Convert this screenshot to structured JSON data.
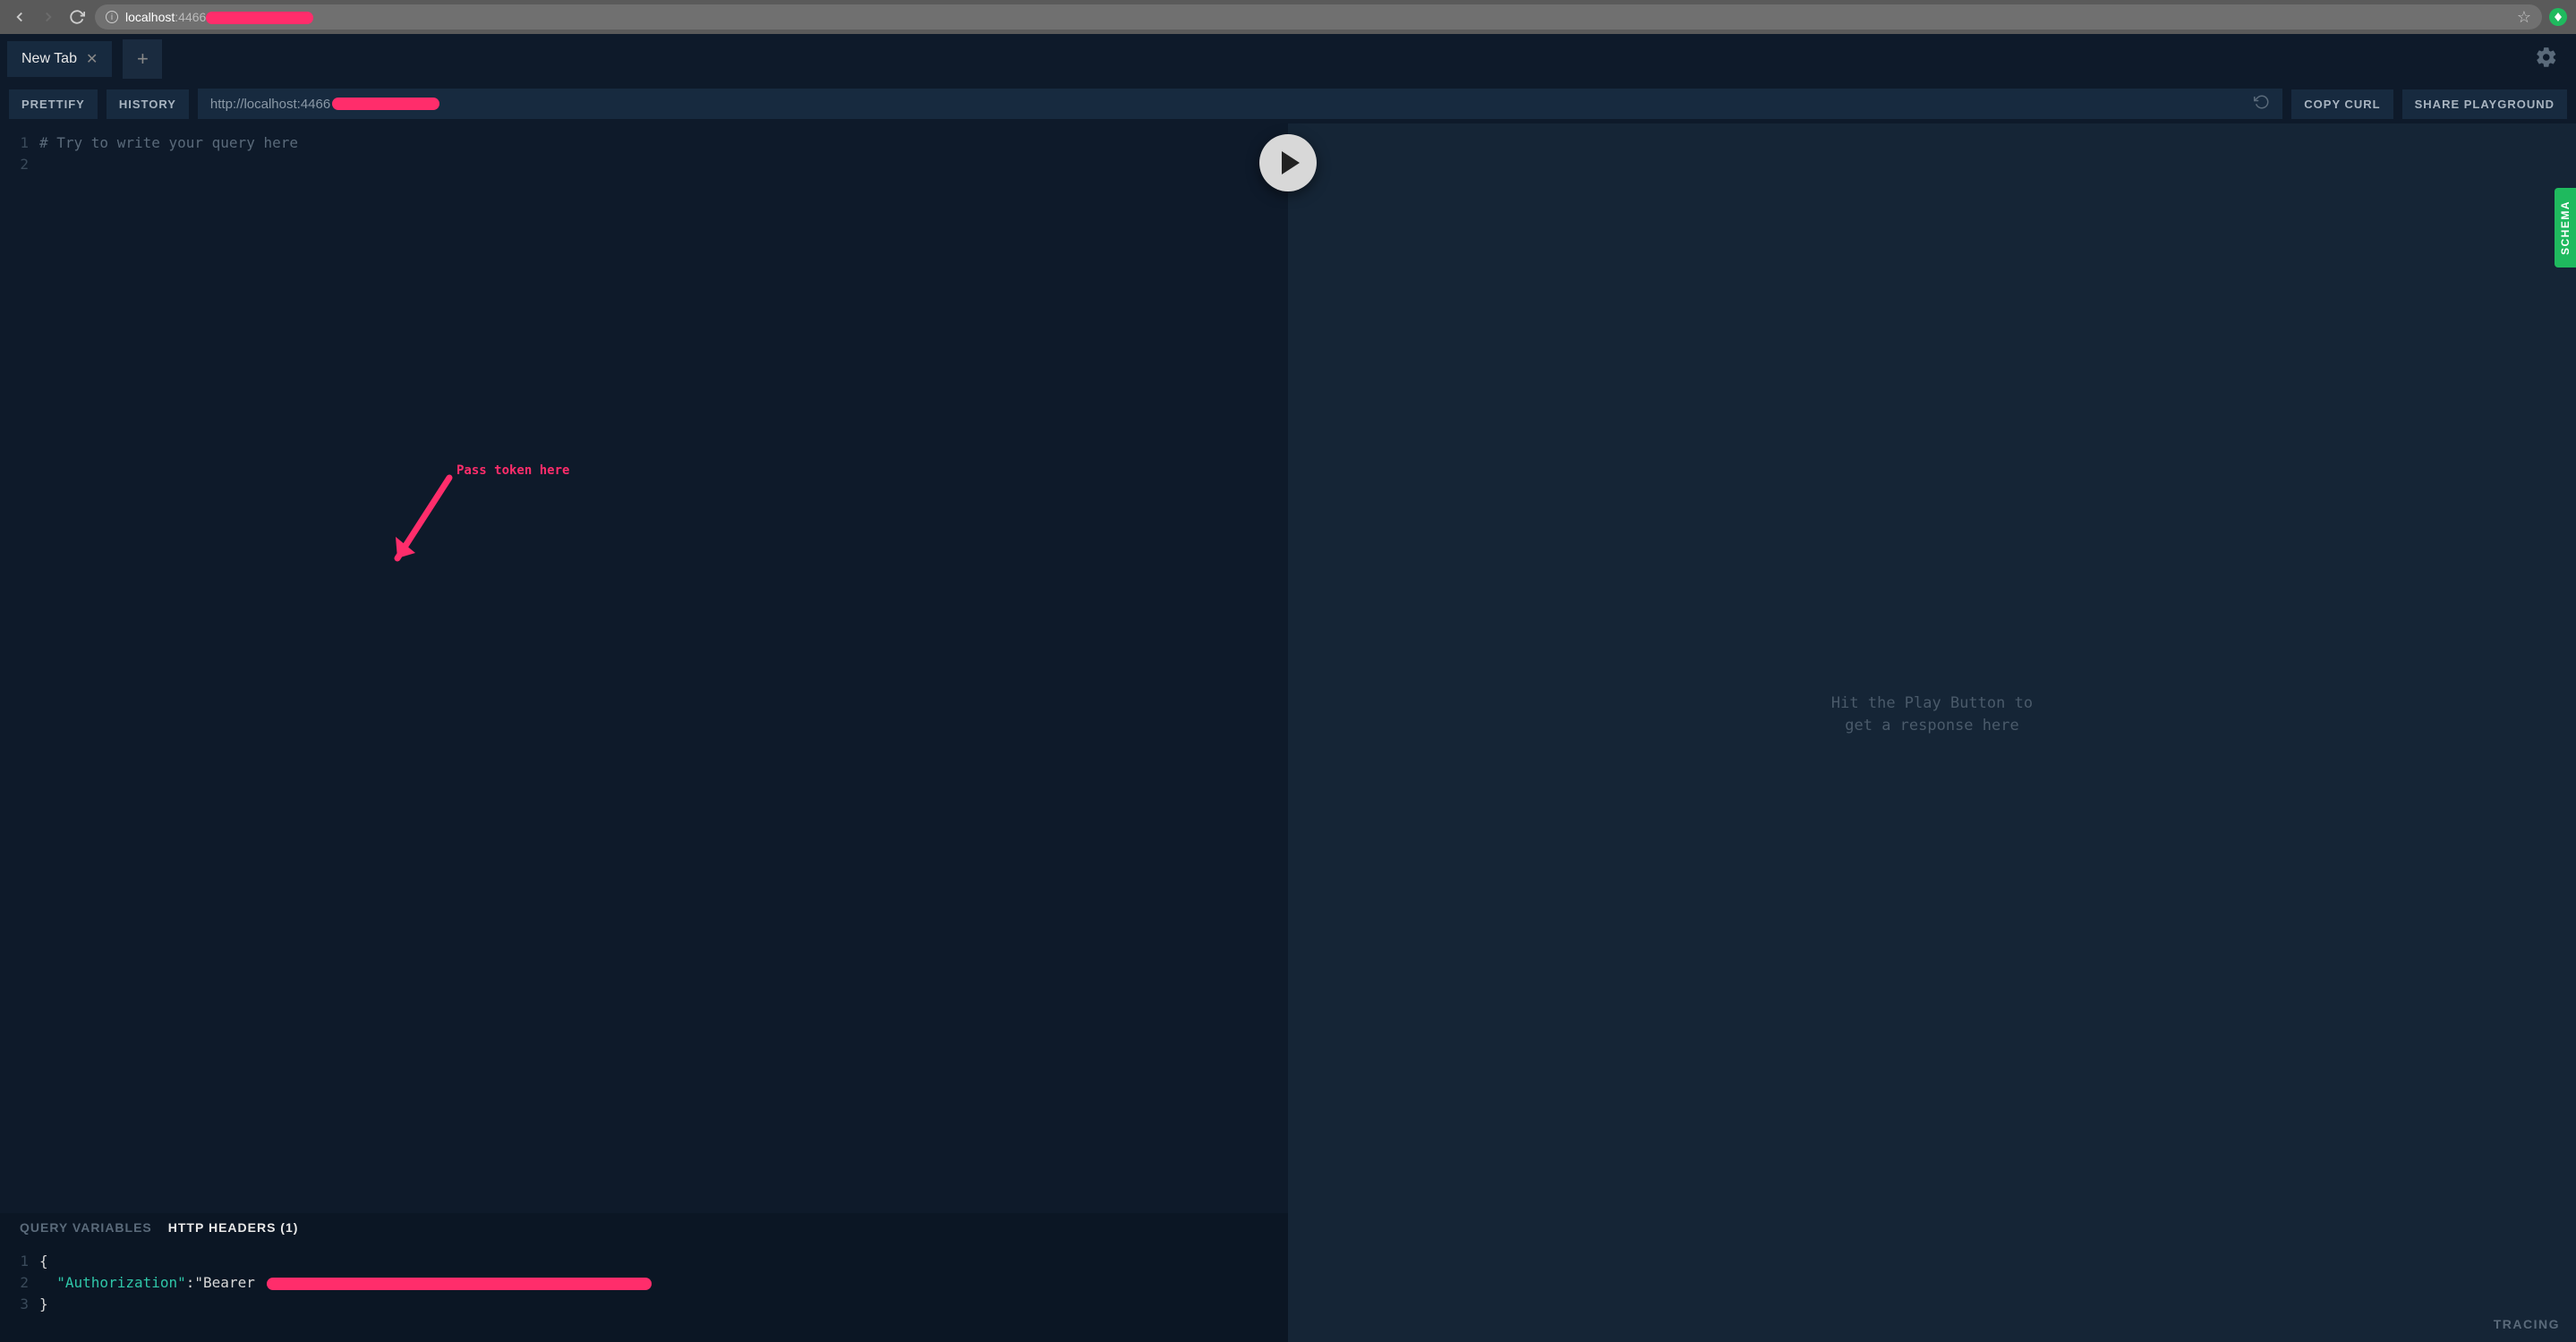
{
  "browser": {
    "url_host": "localhost",
    "url_port": ":4466"
  },
  "tabs": {
    "active_tab": "New Tab",
    "add_label": "+"
  },
  "toolbar": {
    "prettify": "PRETTIFY",
    "history": "HISTORY",
    "endpoint_prefix": "http://localhost:4466",
    "copy_curl": "COPY CURL",
    "share": "SHARE PLAYGROUND"
  },
  "editor": {
    "lines": [
      "1",
      "2"
    ],
    "placeholder": "# Try to write your query here"
  },
  "bottom": {
    "query_variables": "QUERY VARIABLES",
    "http_headers": "HTTP HEADERS (1)"
  },
  "headers": {
    "lines": [
      "1",
      "2",
      "3"
    ],
    "open_brace": "{",
    "key": "\"Authorization\"",
    "colon": ":",
    "value_prefix": "\"Bearer ",
    "close_brace": "}"
  },
  "annotation": {
    "text": "Pass token here"
  },
  "response": {
    "placeholder_line1": "Hit the Play Button to",
    "placeholder_line2": "get a response here",
    "tracing": "TRACING"
  },
  "schema_tab": "SCHEMA"
}
